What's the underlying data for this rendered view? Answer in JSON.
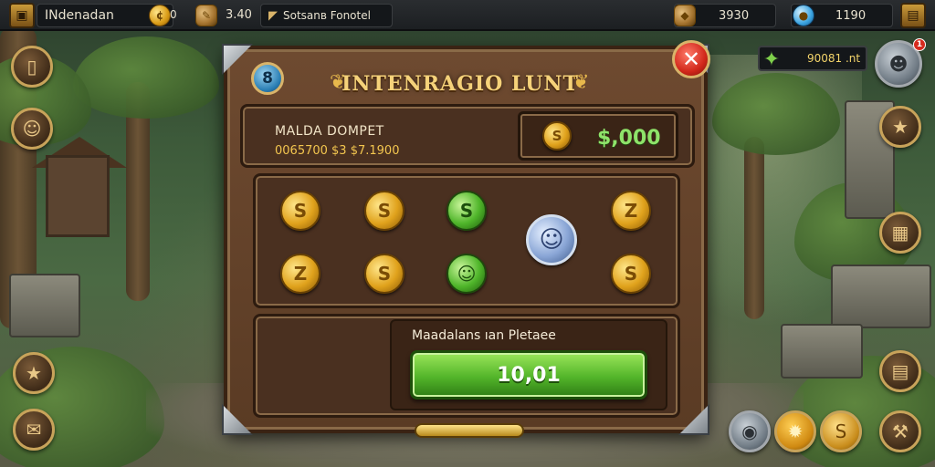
{
  "top_bar": {
    "player_name": "INdenadan",
    "coin_value": "0",
    "stat_value": "3.40",
    "quest_label": "Sotsanв Fonotel",
    "bag_value": "3930",
    "gem_value": "1190"
  },
  "rank_badge": {
    "value": "90081 .nt",
    "notif_count": "1"
  },
  "dialog": {
    "title": "INTENRAGIO LUNT",
    "help_label": "8",
    "close_label": "✕",
    "wallet_title": "MALDA DOMPET",
    "wallet_sub": "0065700 $3 $7.1900",
    "balance": "$,000",
    "coins": [
      {
        "symbol": "S",
        "color": "gold"
      },
      {
        "symbol": "S",
        "color": "gold"
      },
      {
        "symbol": "S",
        "color": "green"
      },
      {
        "symbol": "Z",
        "color": "gold"
      },
      {
        "symbol": "Z",
        "color": "gold"
      },
      {
        "symbol": "S",
        "color": "gold"
      },
      {
        "symbol": "☺",
        "color": "green"
      },
      {
        "symbol": "S",
        "color": "gold"
      },
      {
        "symbol": "☺",
        "color": "blue"
      }
    ],
    "pledge_label": "Maadalans ıan Pletaee",
    "pledge_value": "10,01"
  },
  "icons": {
    "map": "map-icon",
    "profile": "mask-icon",
    "trophy": "star-icon",
    "journal": "journal-icon",
    "scroll": "scroll-icon",
    "shield": "shield-icon",
    "treasure": "treasure-icon",
    "chest": "chest-icon",
    "hammer": "hammer-icon",
    "gem": "gem-icon",
    "menu": "menu-icon"
  },
  "colors": {
    "accent_gold": "#f5d27a",
    "balance_green": "#8fe36a",
    "button_green": "#53b52a",
    "close_red": "#d1271a"
  }
}
